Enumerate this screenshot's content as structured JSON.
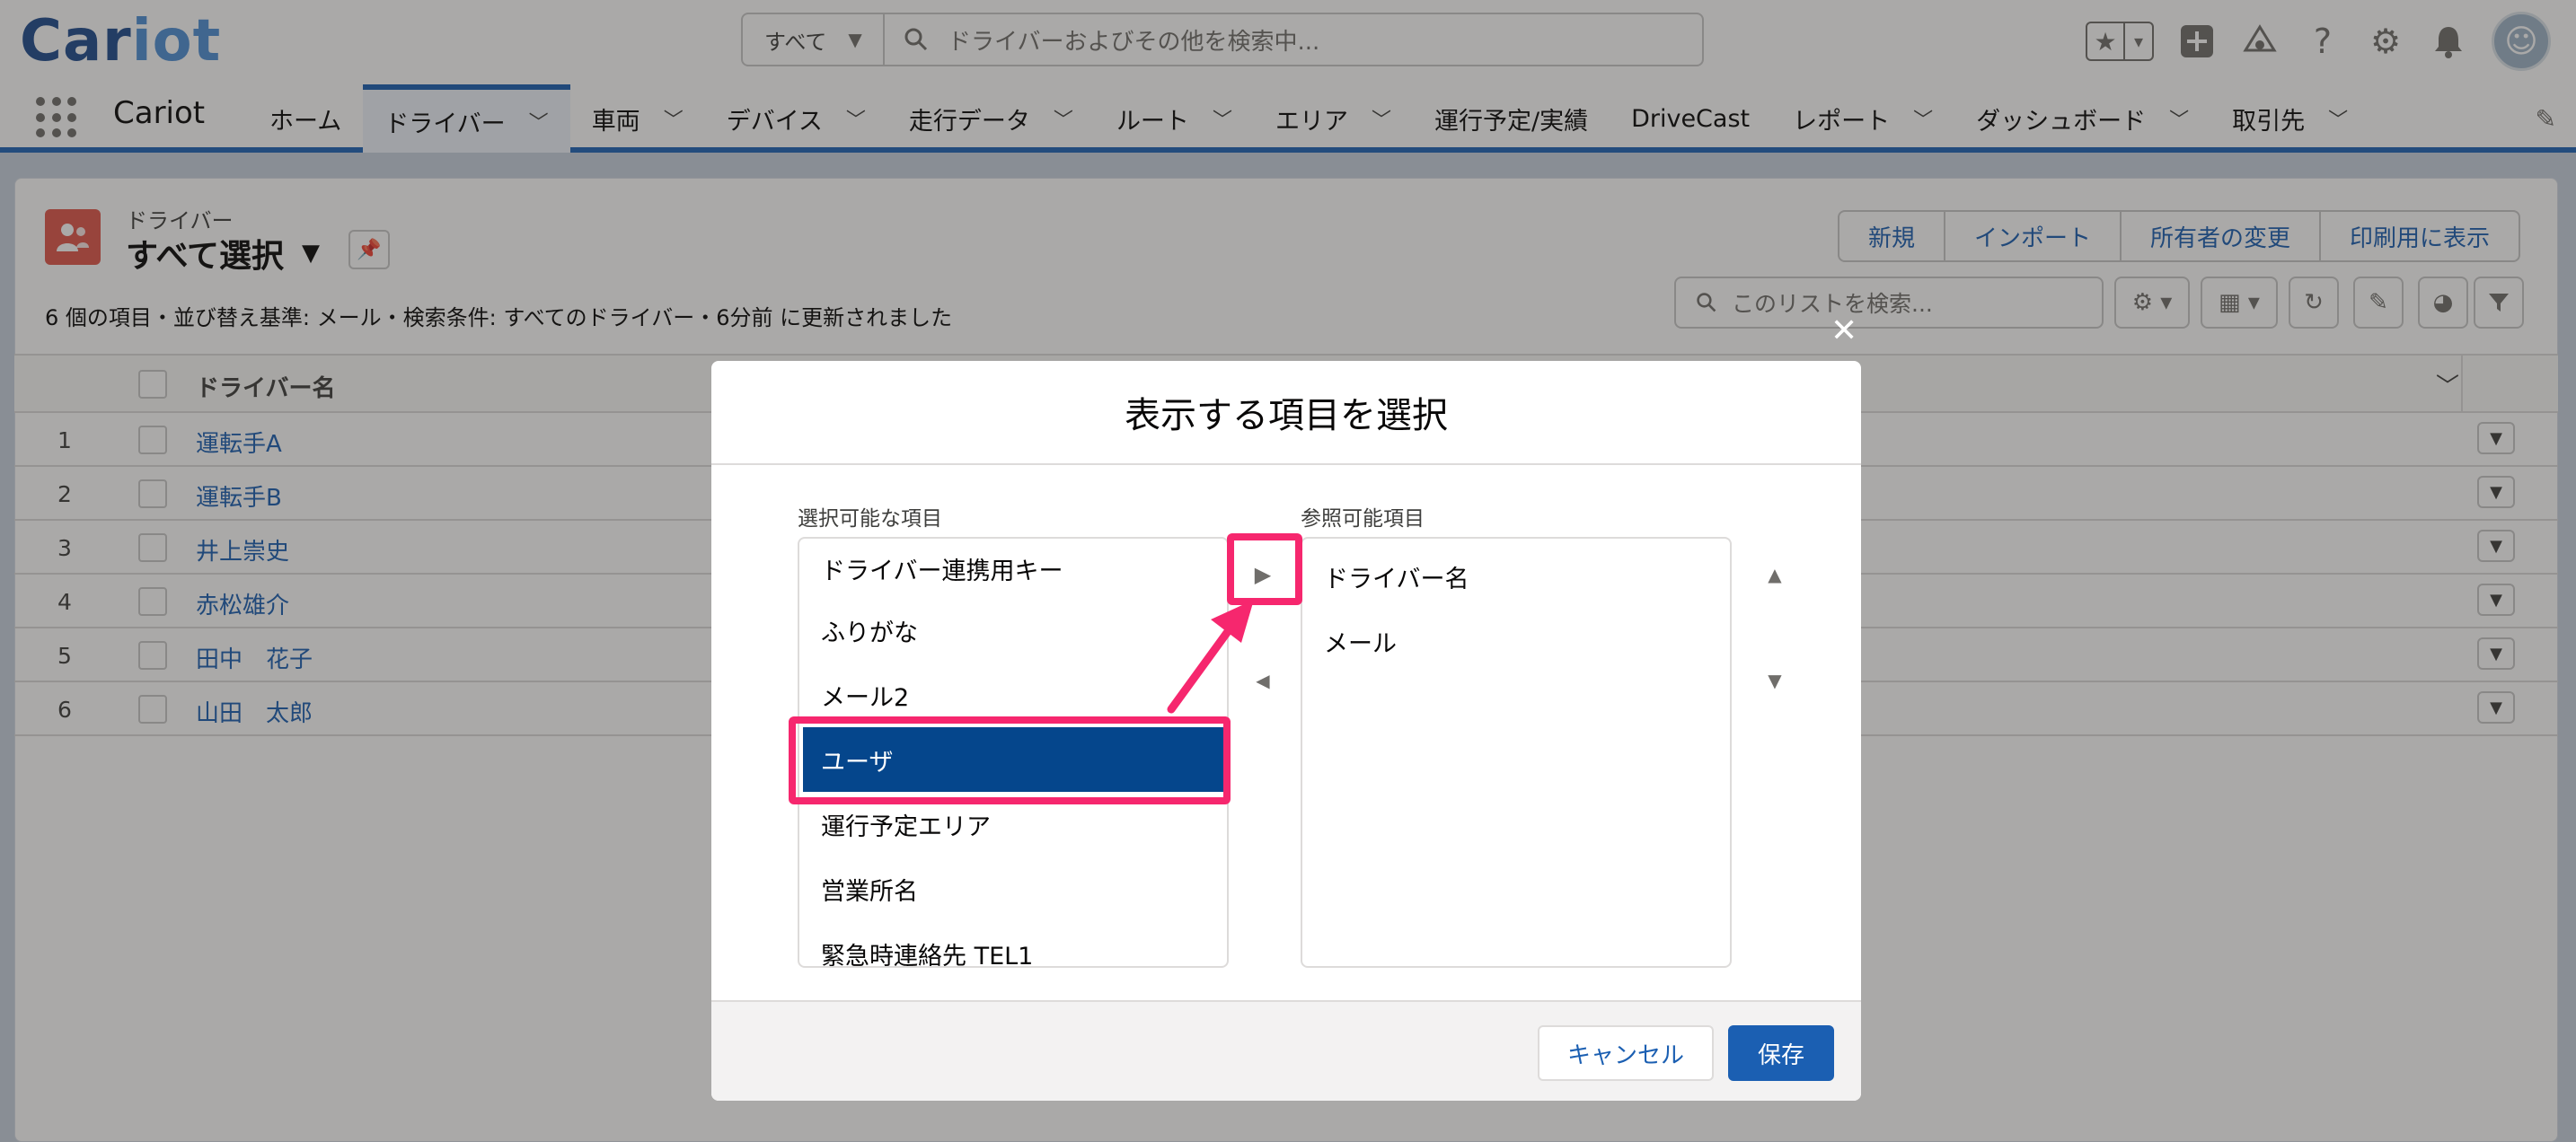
{
  "brand": {
    "logo_main": "Car",
    "logo_accent": "iot"
  },
  "global_search": {
    "scope_label": "すべて",
    "placeholder": "ドライバーおよびその他を検索中..."
  },
  "header_icons": [
    "favorites-icon",
    "favorites-list-icon",
    "add-icon",
    "trailhead-icon",
    "help-icon",
    "setup-gear-icon",
    "notifications-bell-icon",
    "user-avatar"
  ],
  "nav": {
    "app_name": "Cariot",
    "tabs": [
      {
        "label": "ホーム",
        "has_menu": false
      },
      {
        "label": "ドライバー",
        "has_menu": true,
        "active": true
      },
      {
        "label": "車両",
        "has_menu": true
      },
      {
        "label": "デバイス",
        "has_menu": true
      },
      {
        "label": "走行データ",
        "has_menu": true
      },
      {
        "label": "ルート",
        "has_menu": true
      },
      {
        "label": "エリア",
        "has_menu": true
      },
      {
        "label": "運行予定/実績",
        "has_menu": false
      },
      {
        "label": "DriveCast",
        "has_menu": false
      },
      {
        "label": "レポート",
        "has_menu": true
      },
      {
        "label": "ダッシュボード",
        "has_menu": true
      },
      {
        "label": "取引先",
        "has_menu": true
      }
    ]
  },
  "list_view": {
    "object_label": "ドライバー",
    "title": "すべて選択",
    "meta": "6 個の項目・並び替え基準: メール・検索条件: すべてのドライバー・6分前 に更新されました",
    "actions": [
      "新規",
      "インポート",
      "所有者の変更",
      "印刷用に表示"
    ],
    "search_placeholder": "このリストを検索...",
    "column_header": "ドライバー名",
    "rows": [
      {
        "num": "1",
        "name": "運転手A"
      },
      {
        "num": "2",
        "name": "運転手B"
      },
      {
        "num": "3",
        "name": "井上崇史"
      },
      {
        "num": "4",
        "name": "赤松雄介"
      },
      {
        "num": "5",
        "name": "田中　花子"
      },
      {
        "num": "6",
        "name": "山田　太郎"
      }
    ]
  },
  "modal": {
    "title": "表示する項目を選択",
    "available_label": "選択可能な項目",
    "visible_label": "参照可能項目",
    "available_items": [
      "ドライバー連携用キー",
      "ふりがな",
      "メール2",
      "ユーザ",
      "運行予定エリア",
      "営業所名",
      "緊急時連絡先 TEL1"
    ],
    "selected_available": "ユーザ",
    "visible_items": [
      "ドライバー名",
      "メール"
    ],
    "cancel_label": "キャンセル",
    "save_label": "保存"
  },
  "annotation_color": "#f6276e",
  "accent_color": "#1b5fb2"
}
